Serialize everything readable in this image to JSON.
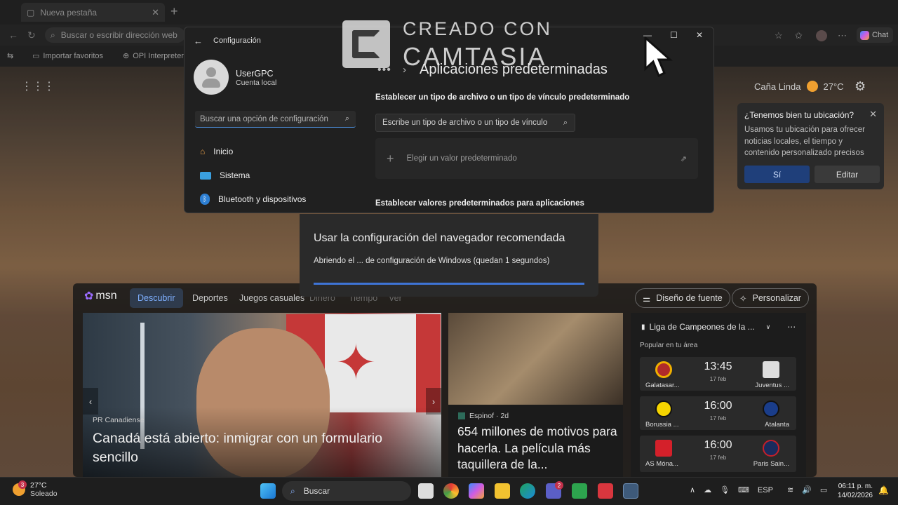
{
  "browser": {
    "tab_title": "Nueva pestaña",
    "address_placeholder": "Buscar o escribir dirección web",
    "favorites": [
      "Importar favoritos",
      "OPI Interpreter"
    ],
    "chat_label": "Chat"
  },
  "newtab": {
    "location": "Caña Linda",
    "temp": "27°C",
    "location_popup": {
      "title": "¿Tenemos bien tu ubicación?",
      "body": "Usamos tu ubicación para ofrecer noticias locales, el tiempo y contenido personalizado precisos",
      "yes": "Sí",
      "edit": "Editar"
    }
  },
  "msn": {
    "logo": "msn",
    "tabs": [
      "Descubrir",
      "Deportes",
      "Juegos casuales",
      "Dinero",
      "Tiempo",
      "Ver"
    ],
    "font_button": "Diseño de fuente",
    "personalize_button": "Personalizar",
    "card1": {
      "source": "PR Canadiense",
      "title": "Canadá está abierto: inmigrar con un formulario sencillo"
    },
    "card2": {
      "source": "Espinof · 2d",
      "title": "654 millones de motivos para hacerla. La película más taquillera de la..."
    },
    "sports": {
      "title": "Liga de Campeones de la ...",
      "subtitle": "Popular en tu área",
      "matches": [
        {
          "home": "Galatasar...",
          "away": "Juventus ...",
          "time": "13:45",
          "date": "17 feb"
        },
        {
          "home": "Borussia ...",
          "away": "Atalanta",
          "time": "16:00",
          "date": "17 feb"
        },
        {
          "home": "AS Móna...",
          "away": "Paris Sain...",
          "time": "16:00",
          "date": "17 feb"
        }
      ]
    }
  },
  "settings": {
    "window_title": "Configuración",
    "user_name": "UserGPC",
    "account_type": "Cuenta local",
    "search_placeholder": "Buscar una opción de configuración",
    "nav": [
      "Inicio",
      "Sistema",
      "Bluetooth y dispositivos"
    ],
    "breadcrumb": "•••",
    "heading": "Aplicaciones predeterminadas",
    "filetype_label": "Establecer un tipo de archivo o un tipo de vínculo predeterminado",
    "filetype_placeholder": "Escribe un tipo de archivo o un tipo de vínculo",
    "choose_default": "Elegir un valor predeterminado",
    "apps_label": "Establecer valores predeterminados para aplicaciones"
  },
  "watermark": {
    "line1": "CREADO CON",
    "line2": "CAMTASIA"
  },
  "dialog": {
    "title": "Usar la configuración del navegador recomendada",
    "message": "Abriendo el ... de configuración de Windows (quedan 1 segundos)",
    "progress": 1.0
  },
  "taskbar": {
    "weather_temp": "27°C",
    "weather_cond": "Soleado",
    "weather_badge": "3",
    "search_label": "Buscar",
    "teams_badge": "2",
    "language": "ESP",
    "time": "06:11 p. m.",
    "date": "14/02/2026"
  }
}
